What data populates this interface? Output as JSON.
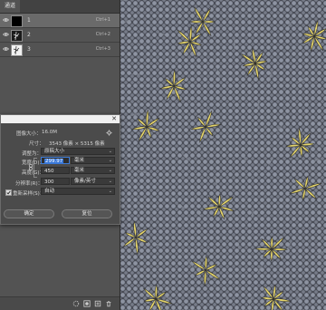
{
  "panel": {
    "tab_label": "通道",
    "channels": [
      {
        "name": "1",
        "shortcut": "Ctrl+1",
        "selected": true
      },
      {
        "name": "2",
        "shortcut": "Ctrl+2",
        "selected": false
      },
      {
        "name": "3",
        "shortcut": "Ctrl+3",
        "selected": false
      }
    ]
  },
  "dialog": {
    "image_size_label": "图像大小：",
    "image_size_value": "16.0M",
    "dimensions_label": "尺寸：",
    "dimensions_value": "3543 像素 × 5315 像素",
    "fit_label": "调整为：",
    "fit_value": "原稿大小",
    "width_label": "宽度(D)：",
    "width_value": "299.97",
    "width_unit": "毫米",
    "height_label": "高度(G)：",
    "height_value": "450",
    "height_unit": "毫米",
    "resolution_label": "分辨率(R)：",
    "resolution_value": "300",
    "resolution_unit": "像素/英寸",
    "resample_label": "重新采样(S)：",
    "resample_value": "自动",
    "ok_label": "确定",
    "reset_label": "复位"
  },
  "colors": {
    "accent": "#3a78d8",
    "leaf": "#e3d36a",
    "canvas_bg": "#4a4d57"
  }
}
